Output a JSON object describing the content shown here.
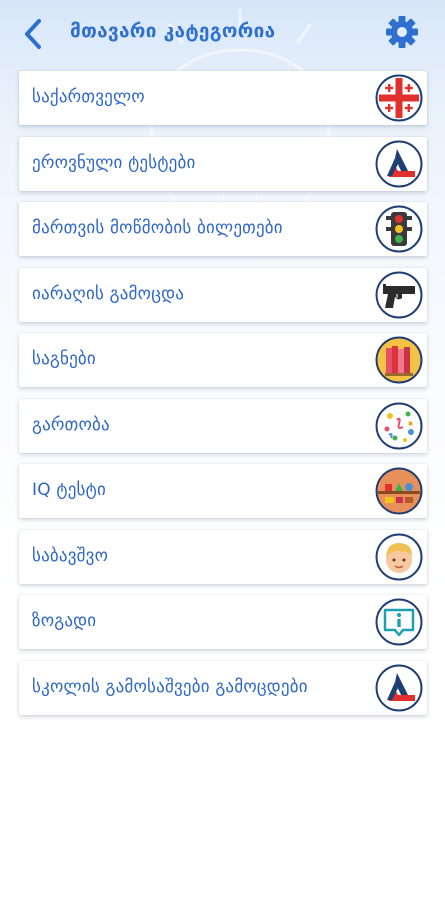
{
  "header": {
    "title": "მთავარი კატეგორია",
    "back_icon": "chevron-left-icon",
    "settings_icon": "gear-icon"
  },
  "colors": {
    "accent": "#2f6fcf",
    "label": "#2d66c6",
    "card_background": "#ffffff"
  },
  "categories": [
    {
      "label": "საქართველო",
      "icon": "georgia-flag-icon"
    },
    {
      "label": "ეროვნული ტესტები",
      "icon": "national-exams-logo-icon"
    },
    {
      "label": "მართვის მოწმობის ბილეთები",
      "icon": "traffic-light-icon"
    },
    {
      "label": "იარაღის გამოცდა",
      "icon": "pistol-icon"
    },
    {
      "label": "საგნები",
      "icon": "books-icon"
    },
    {
      "label": "გართობა",
      "icon": "confetti-icon"
    },
    {
      "label": "IQ ტესტი",
      "icon": "shapes-icon"
    },
    {
      "label": "საბავშვო",
      "icon": "child-face-icon"
    },
    {
      "label": "ზოგადი",
      "icon": "info-bubble-icon"
    },
    {
      "label": "სკოლის გამოსაშვები გამოცდები",
      "icon": "national-exams-logo-icon"
    }
  ]
}
